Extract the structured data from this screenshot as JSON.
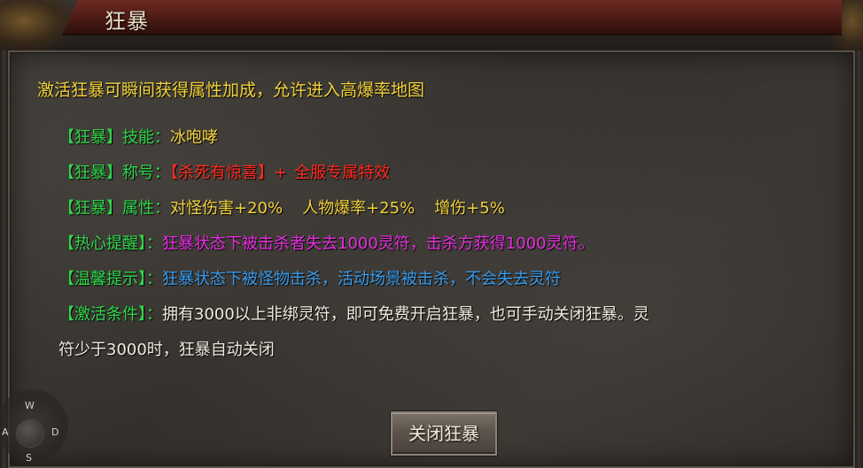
{
  "window": {
    "title": "狂暴"
  },
  "intro": "激活狂暴可瞬间获得属性加成，允许进入高爆率地图",
  "rows": {
    "skill": {
      "label": "【狂暴】技能：",
      "value": "冰咆哮"
    },
    "title_row": {
      "label": "【狂暴】称号：",
      "value1": "【杀死有惊喜】+",
      "value2": "全服专属特效"
    },
    "attr": {
      "label": "【狂暴】属性：",
      "v1": "对怪伤害+20%",
      "v2": "人物爆率+25%",
      "v3": "增伤+5%"
    },
    "tip": {
      "label": "【热心提醒】：",
      "value": "狂暴状态下被击杀者失去1000灵符，击杀方获得1000灵符。"
    },
    "warm": {
      "label": "【温馨提示】：",
      "value": "狂暴状态下被怪物击杀，活动场景被击杀，不会失去灵符"
    },
    "cond": {
      "label": "【激活条件】：",
      "value_line1": "拥有3000以上非绑灵符，即可免费开启狂暴，也可手动关闭狂暴。灵",
      "value_line2": "符少于3000时，狂暴自动关闭"
    }
  },
  "buttons": {
    "close": "关闭狂暴"
  },
  "compass": {
    "n": "W",
    "w": "A",
    "e": "D",
    "s": "S"
  },
  "colors": {
    "label": "#2fd74a",
    "intro": "#f2d23c",
    "red": "#ff2b20",
    "magenta": "#e62ee0",
    "blue": "#3a9bea"
  }
}
